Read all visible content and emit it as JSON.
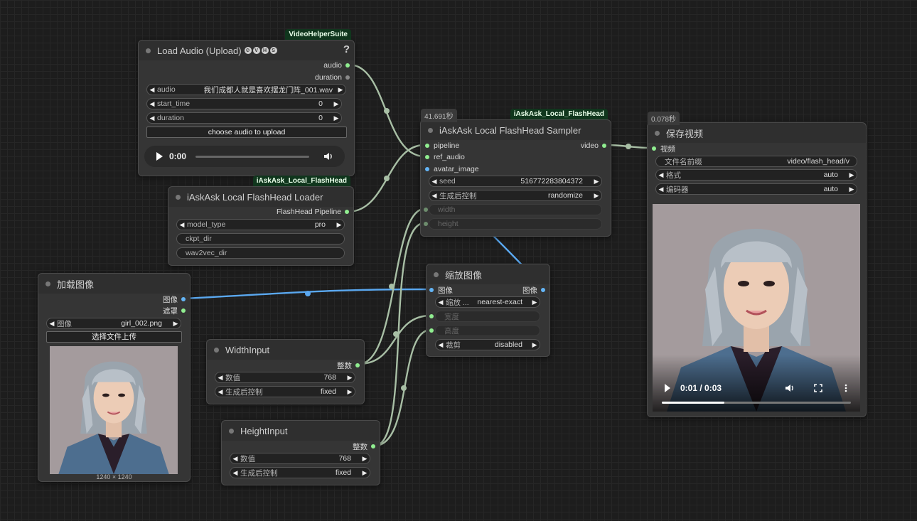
{
  "canvas": {
    "background": "#1d1d1d"
  },
  "colors": {
    "wire_green": "#a8bfa5",
    "wire_blue": "#5aa8f0",
    "badge_bg": "#10361d"
  },
  "load_audio": {
    "badge": "VideoHelperSuite",
    "title": "Load Audio (Upload)",
    "vhs_letters": [
      "V",
      "H",
      "S"
    ],
    "help": "?",
    "outputs": [
      "audio",
      "duration"
    ],
    "widgets": [
      {
        "label": "audio",
        "value": "我们成都人就是喜欢摆龙门阵_001.wav"
      },
      {
        "label": "start_time",
        "value": "0"
      },
      {
        "label": "duration",
        "value": "0"
      }
    ],
    "upload_button": "choose audio to upload",
    "player_time": "0:00"
  },
  "loader": {
    "badge": "iAskAsk_Local_FlashHead",
    "title": "iAskAsk Local FlashHead Loader",
    "output": "FlashHead Pipeline",
    "model_type_label": "model_type",
    "model_type_value": "pro",
    "ckpt_dir": "ckpt_dir",
    "wav2vec_dir": "wav2vec_dir"
  },
  "sampler": {
    "timer": "41.691秒",
    "badge": "iAskAsk_Local_FlashHead",
    "title": "iAskAsk Local FlashHead Sampler",
    "inputs": [
      "pipeline",
      "ref_audio",
      "avatar_image"
    ],
    "output": "video",
    "seed_label": "seed",
    "seed_value": "516772283804372",
    "control_label": "生成后控制",
    "control_value": "randomize",
    "width_label": "width",
    "height_label": "height"
  },
  "save_video": {
    "timer": "0.078秒",
    "title": "保存视频",
    "input": "视频",
    "prefix_label": "文件名前缀",
    "prefix_value": "video/flash_head/v",
    "format_label": "格式",
    "format_value": "auto",
    "codec_label": "编码器",
    "codec_value": "auto",
    "time": "0:01 / 0:03",
    "progress": 0.33
  },
  "load_image": {
    "title": "加载图像",
    "outputs": [
      "图像",
      "遮罩"
    ],
    "image_label": "图像",
    "image_value": "girl_002.png",
    "upload_button": "选择文件上传",
    "dimensions": "1240 × 1240"
  },
  "scale_image": {
    "title": "缩放图像",
    "input": "图像",
    "output": "图像",
    "method_label": "缩放 ...",
    "method_value": "nearest-exact",
    "width_label": "宽度",
    "height_label": "高度",
    "crop_label": "裁剪",
    "crop_value": "disabled"
  },
  "width_input": {
    "title": "WidthInput",
    "output": "整数",
    "value_label": "数值",
    "value": "768",
    "control_label": "生成后控制",
    "control_value": "fixed"
  },
  "height_input": {
    "title": "HeightInput",
    "output": "整数",
    "value_label": "数值",
    "value": "768",
    "control_label": "生成后控制",
    "control_value": "fixed"
  }
}
